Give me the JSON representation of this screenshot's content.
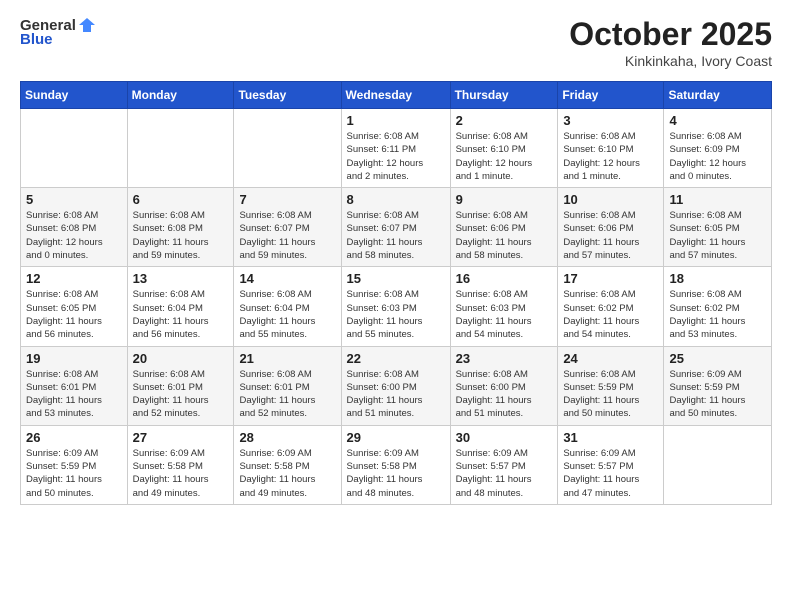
{
  "header": {
    "logo_line1": "General",
    "logo_line2": "Blue",
    "month": "October 2025",
    "location": "Kinkinkaha, Ivory Coast"
  },
  "weekdays": [
    "Sunday",
    "Monday",
    "Tuesday",
    "Wednesday",
    "Thursday",
    "Friday",
    "Saturday"
  ],
  "weeks": [
    [
      {
        "day": "",
        "info": ""
      },
      {
        "day": "",
        "info": ""
      },
      {
        "day": "",
        "info": ""
      },
      {
        "day": "1",
        "info": "Sunrise: 6:08 AM\nSunset: 6:11 PM\nDaylight: 12 hours\nand 2 minutes."
      },
      {
        "day": "2",
        "info": "Sunrise: 6:08 AM\nSunset: 6:10 PM\nDaylight: 12 hours\nand 1 minute."
      },
      {
        "day": "3",
        "info": "Sunrise: 6:08 AM\nSunset: 6:10 PM\nDaylight: 12 hours\nand 1 minute."
      },
      {
        "day": "4",
        "info": "Sunrise: 6:08 AM\nSunset: 6:09 PM\nDaylight: 12 hours\nand 0 minutes."
      }
    ],
    [
      {
        "day": "5",
        "info": "Sunrise: 6:08 AM\nSunset: 6:08 PM\nDaylight: 12 hours\nand 0 minutes."
      },
      {
        "day": "6",
        "info": "Sunrise: 6:08 AM\nSunset: 6:08 PM\nDaylight: 11 hours\nand 59 minutes."
      },
      {
        "day": "7",
        "info": "Sunrise: 6:08 AM\nSunset: 6:07 PM\nDaylight: 11 hours\nand 59 minutes."
      },
      {
        "day": "8",
        "info": "Sunrise: 6:08 AM\nSunset: 6:07 PM\nDaylight: 11 hours\nand 58 minutes."
      },
      {
        "day": "9",
        "info": "Sunrise: 6:08 AM\nSunset: 6:06 PM\nDaylight: 11 hours\nand 58 minutes."
      },
      {
        "day": "10",
        "info": "Sunrise: 6:08 AM\nSunset: 6:06 PM\nDaylight: 11 hours\nand 57 minutes."
      },
      {
        "day": "11",
        "info": "Sunrise: 6:08 AM\nSunset: 6:05 PM\nDaylight: 11 hours\nand 57 minutes."
      }
    ],
    [
      {
        "day": "12",
        "info": "Sunrise: 6:08 AM\nSunset: 6:05 PM\nDaylight: 11 hours\nand 56 minutes."
      },
      {
        "day": "13",
        "info": "Sunrise: 6:08 AM\nSunset: 6:04 PM\nDaylight: 11 hours\nand 56 minutes."
      },
      {
        "day": "14",
        "info": "Sunrise: 6:08 AM\nSunset: 6:04 PM\nDaylight: 11 hours\nand 55 minutes."
      },
      {
        "day": "15",
        "info": "Sunrise: 6:08 AM\nSunset: 6:03 PM\nDaylight: 11 hours\nand 55 minutes."
      },
      {
        "day": "16",
        "info": "Sunrise: 6:08 AM\nSunset: 6:03 PM\nDaylight: 11 hours\nand 54 minutes."
      },
      {
        "day": "17",
        "info": "Sunrise: 6:08 AM\nSunset: 6:02 PM\nDaylight: 11 hours\nand 54 minutes."
      },
      {
        "day": "18",
        "info": "Sunrise: 6:08 AM\nSunset: 6:02 PM\nDaylight: 11 hours\nand 53 minutes."
      }
    ],
    [
      {
        "day": "19",
        "info": "Sunrise: 6:08 AM\nSunset: 6:01 PM\nDaylight: 11 hours\nand 53 minutes."
      },
      {
        "day": "20",
        "info": "Sunrise: 6:08 AM\nSunset: 6:01 PM\nDaylight: 11 hours\nand 52 minutes."
      },
      {
        "day": "21",
        "info": "Sunrise: 6:08 AM\nSunset: 6:01 PM\nDaylight: 11 hours\nand 52 minutes."
      },
      {
        "day": "22",
        "info": "Sunrise: 6:08 AM\nSunset: 6:00 PM\nDaylight: 11 hours\nand 51 minutes."
      },
      {
        "day": "23",
        "info": "Sunrise: 6:08 AM\nSunset: 6:00 PM\nDaylight: 11 hours\nand 51 minutes."
      },
      {
        "day": "24",
        "info": "Sunrise: 6:08 AM\nSunset: 5:59 PM\nDaylight: 11 hours\nand 50 minutes."
      },
      {
        "day": "25",
        "info": "Sunrise: 6:09 AM\nSunset: 5:59 PM\nDaylight: 11 hours\nand 50 minutes."
      }
    ],
    [
      {
        "day": "26",
        "info": "Sunrise: 6:09 AM\nSunset: 5:59 PM\nDaylight: 11 hours\nand 50 minutes."
      },
      {
        "day": "27",
        "info": "Sunrise: 6:09 AM\nSunset: 5:58 PM\nDaylight: 11 hours\nand 49 minutes."
      },
      {
        "day": "28",
        "info": "Sunrise: 6:09 AM\nSunset: 5:58 PM\nDaylight: 11 hours\nand 49 minutes."
      },
      {
        "day": "29",
        "info": "Sunrise: 6:09 AM\nSunset: 5:58 PM\nDaylight: 11 hours\nand 48 minutes."
      },
      {
        "day": "30",
        "info": "Sunrise: 6:09 AM\nSunset: 5:57 PM\nDaylight: 11 hours\nand 48 minutes."
      },
      {
        "day": "31",
        "info": "Sunrise: 6:09 AM\nSunset: 5:57 PM\nDaylight: 11 hours\nand 47 minutes."
      },
      {
        "day": "",
        "info": ""
      }
    ]
  ]
}
